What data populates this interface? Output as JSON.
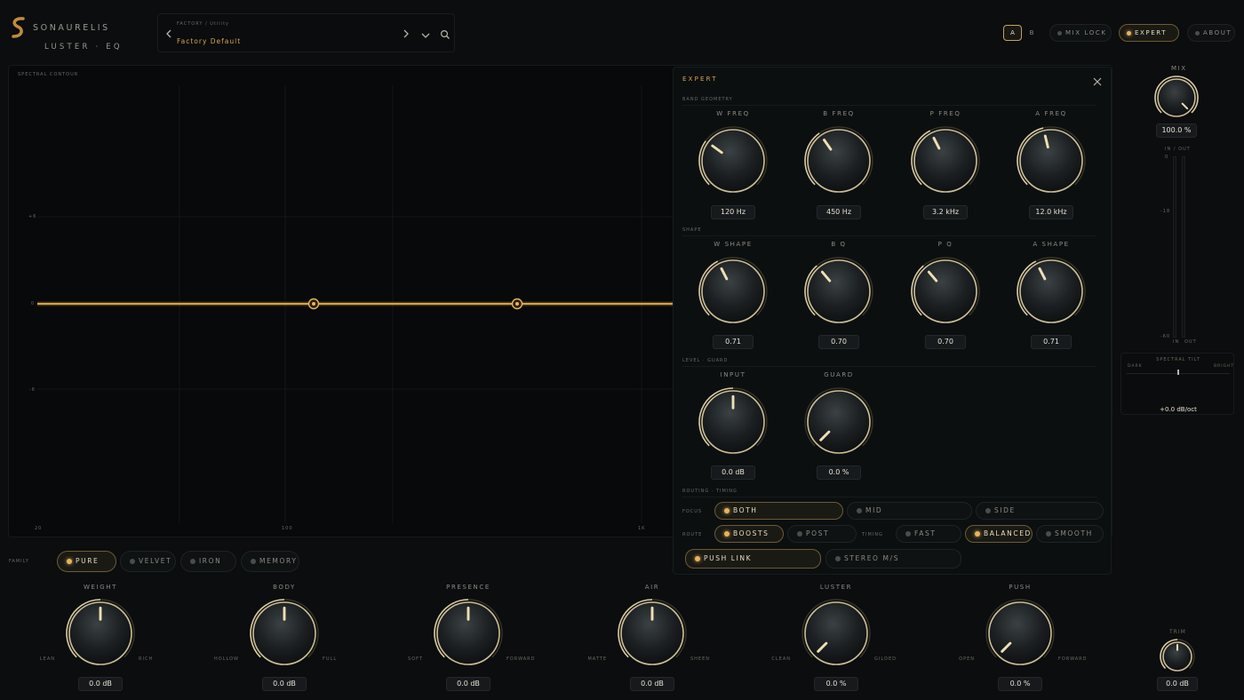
{
  "brand": {
    "name": "SONAURELIS",
    "product": "LUSTER · EQ"
  },
  "preset": {
    "category": "FACTORY / Utility",
    "name": "Factory Default"
  },
  "header": {
    "a": "A",
    "b": "B",
    "mix_lock": "MIX LOCK",
    "expert": "EXPERT",
    "about": "ABOUT"
  },
  "spectrum": {
    "title": "SPECTRAL CONTOUR",
    "y_ticks": [
      "+6",
      "0",
      "-6"
    ],
    "x_ticks": [
      "20",
      "100",
      "1k"
    ]
  },
  "expert": {
    "title": "EXPERT",
    "sections": {
      "band": "BAND GEOMETRY",
      "shape": "SHAPE",
      "level": "LEVEL · GUARD",
      "routing": "ROUTING · TIMING"
    },
    "band_knobs": [
      {
        "label": "W FREQ",
        "value": "120 Hz",
        "level": 0.3
      },
      {
        "label": "B FREQ",
        "value": "450 Hz",
        "level": 0.37
      },
      {
        "label": "P FREQ",
        "value": "3.2 kHz",
        "level": 0.4
      },
      {
        "label": "A FREQ",
        "value": "12.0 kHz",
        "level": 0.45
      }
    ],
    "shape_knobs": [
      {
        "label": "W SHAPE",
        "value": "0.71",
        "level": 0.4
      },
      {
        "label": "B Q",
        "value": "0.70",
        "level": 0.35
      },
      {
        "label": "P Q",
        "value": "0.70",
        "level": 0.35
      },
      {
        "label": "A SHAPE",
        "value": "0.71",
        "level": 0.4
      }
    ],
    "level_knobs": [
      {
        "label": "INPUT",
        "value": "0.0 dB",
        "level": 0.5
      },
      {
        "label": "GUARD",
        "value": "0.0 %",
        "level": 0.0
      }
    ],
    "focus_label": "FOCUS",
    "focus_options": [
      "BOTH",
      "MID",
      "SIDE"
    ],
    "route_label": "ROUTE",
    "route_options": [
      "BOOSTS",
      "POST"
    ],
    "timing_label": "TIMING",
    "timing_options": [
      "FAST",
      "BALANCED",
      "SMOOTH"
    ],
    "link_options": [
      "PUSH LINK",
      "STEREO M/S"
    ]
  },
  "right": {
    "mix_label": "MIX",
    "mix_value": "100.0 %",
    "mix_level": 1.0,
    "io_label": "IN / OUT",
    "io_ticks": [
      "0",
      "-18",
      "-60"
    ],
    "io_in": "IN",
    "io_out": "OUT",
    "tilt_title": "SPECTRAL TILT",
    "tilt_left": "DARK",
    "tilt_right": "BRIGHT",
    "tilt_value": "+0.0 dB/oct",
    "trim_label": "TRIM",
    "trim_value": "0.0 dB",
    "trim_level": 0.5
  },
  "family": {
    "label": "FAMILY",
    "options": [
      "PURE",
      "VELVET",
      "IRON",
      "MEMORY"
    ]
  },
  "main_knobs": [
    {
      "label": "WEIGHT",
      "left": "LEAN",
      "right": "RICH",
      "value": "0.0 dB",
      "level": 0.5
    },
    {
      "label": "BODY",
      "left": "HOLLOW",
      "right": "FULL",
      "value": "0.0 dB",
      "level": 0.5
    },
    {
      "label": "PRESENCE",
      "left": "SOFT",
      "right": "FORWARD",
      "value": "0.0 dB",
      "level": 0.5
    },
    {
      "label": "AIR",
      "left": "MATTE",
      "right": "SHEEN",
      "value": "0.0 dB",
      "level": 0.5
    },
    {
      "label": "LUSTER",
      "left": "CLEAN",
      "right": "GILDED",
      "value": "0.0 %",
      "level": 0.0
    },
    {
      "label": "PUSH",
      "left": "OPEN",
      "right": "FORWARD",
      "value": "0.0 %",
      "level": 0.0
    }
  ],
  "colors": {
    "accent": "#e8b45a",
    "gold_ring": "#d9c9a0",
    "bg": "#0b0d0e"
  }
}
